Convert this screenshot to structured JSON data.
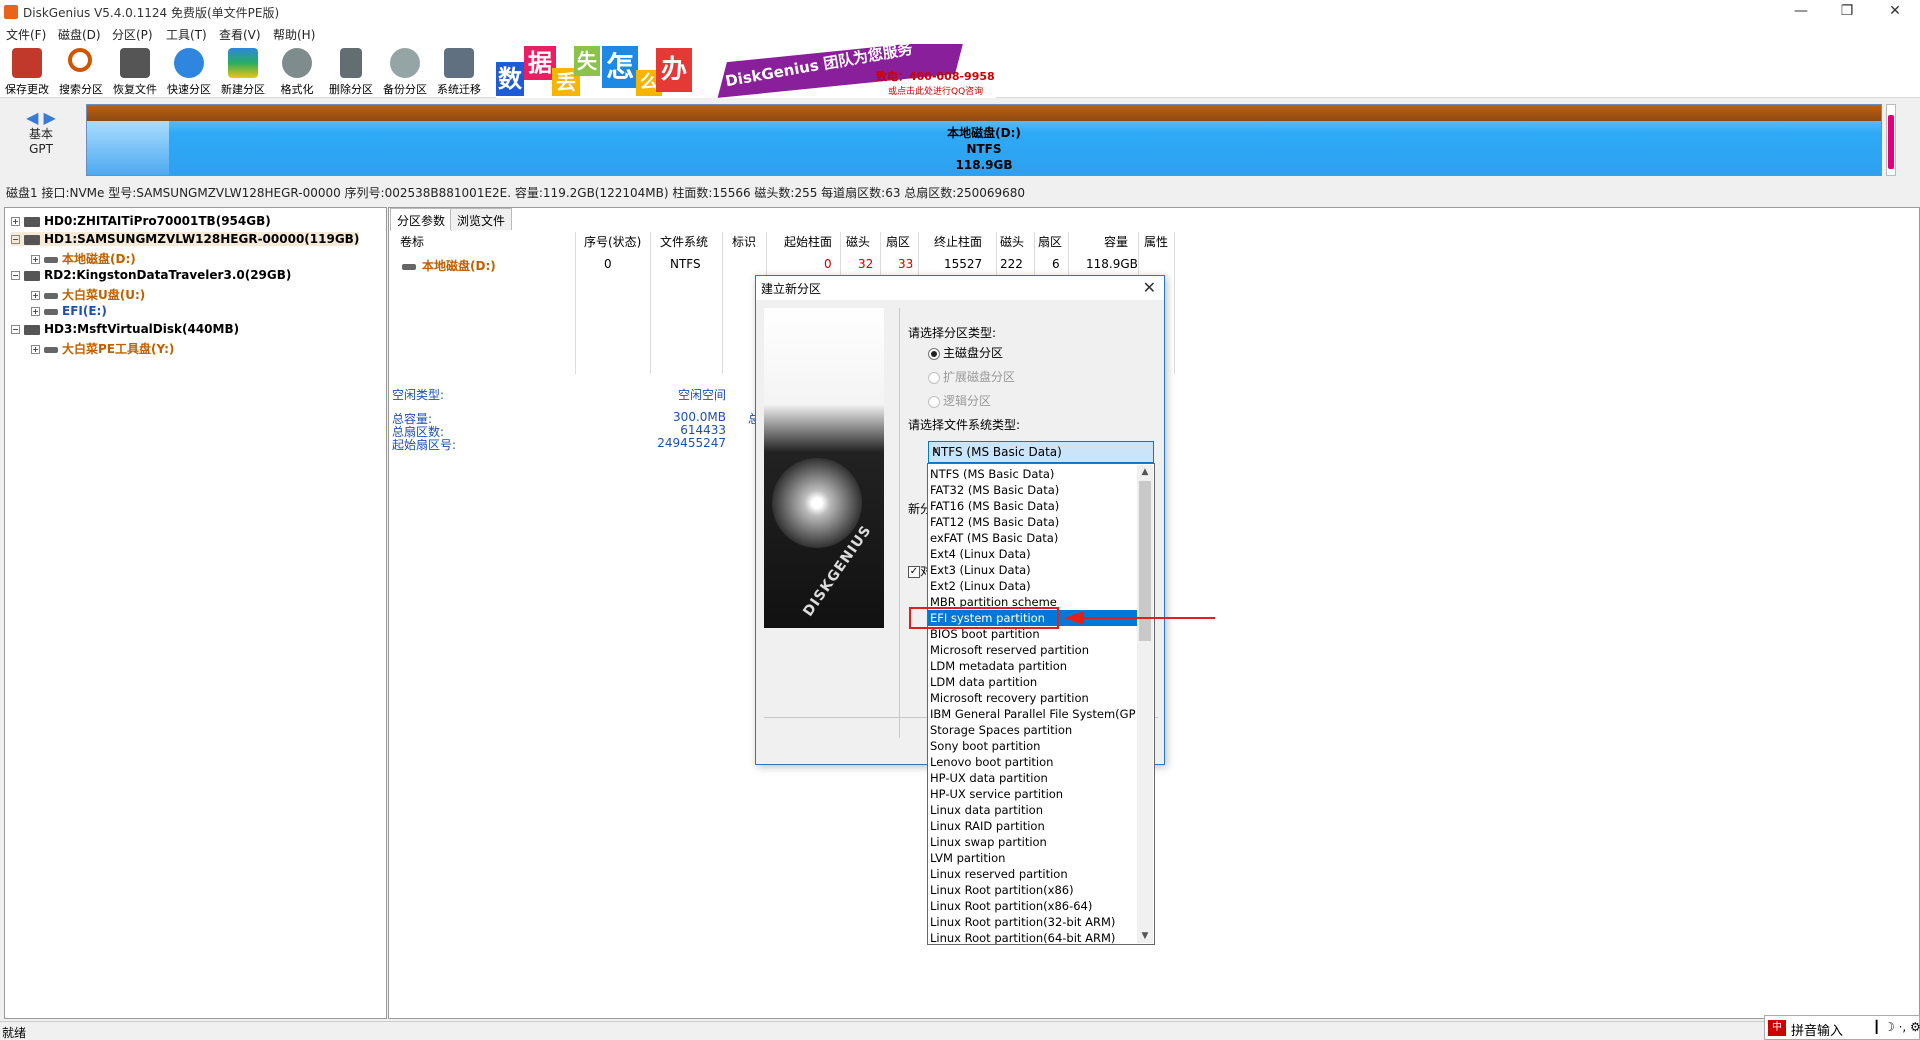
{
  "window": {
    "title": "DiskGenius V5.4.0.1124 免费版(单文件PE版)",
    "minimize_glyph": "—",
    "restore_glyph": "❐",
    "close_glyph": "✕"
  },
  "menu": [
    "文件(F)",
    "磁盘(D)",
    "分区(P)",
    "工具(T)",
    "查看(V)",
    "帮助(H)"
  ],
  "toolbar": [
    {
      "label": "保存更改",
      "icon": "save-icon",
      "color": "#c0392b"
    },
    {
      "label": "搜索分区",
      "icon": "search-icon",
      "color": "#d35400"
    },
    {
      "label": "恢复文件",
      "icon": "recover-icon",
      "color": "#555555"
    },
    {
      "label": "快速分区",
      "icon": "quick-partition-icon",
      "color": "#2e86de"
    },
    {
      "label": "新建分区",
      "icon": "new-partition-icon",
      "color": "#27ae60"
    },
    {
      "label": "格式化",
      "icon": "format-icon",
      "color": "#7f8c8d"
    },
    {
      "label": "删除分区",
      "icon": "delete-icon",
      "color": "#636e72"
    },
    {
      "label": "备份分区",
      "icon": "backup-icon",
      "color": "#95a5a6"
    },
    {
      "label": "系统迁移",
      "icon": "migrate-icon",
      "color": "#607080"
    }
  ],
  "banner": {
    "chars": [
      "数",
      "据",
      "丢",
      "失",
      "怎",
      "么",
      "办"
    ],
    "slogan": "DiskGenius 团队为您服务",
    "phone": "致电：400-008-9958",
    "qq": "或点击此处进行QQ咨询"
  },
  "disk_nav": {
    "line1": "基本",
    "line2": "GPT",
    "arrows": "◀ ▶"
  },
  "partition_bar": {
    "name": "本地磁盘(D:)",
    "fs": "NTFS",
    "size": "118.9GB"
  },
  "disk_info": "磁盘1 接口:NVMe  型号:SAMSUNGMZVLW128HEGR-00000  序列号:002538B881001E2E.  容量:119.2GB(122104MB)  柱面数:15566  磁头数:255  每道扇区数:63  总扇区数:250069680",
  "tree": [
    {
      "label": "HD0:ZHITAITiPro70001TB(954GB)",
      "kind": "disk"
    },
    {
      "label": "HD1:SAMSUNGMZVLW128HEGR-00000(119GB)",
      "kind": "disk"
    },
    {
      "label": "本地磁盘(D:)",
      "kind": "part"
    },
    {
      "label": "RD2:KingstonDataTraveler3.0(29GB)",
      "kind": "disk"
    },
    {
      "label": "大白菜U盘(U:)",
      "kind": "part"
    },
    {
      "label": "EFI(E:)",
      "kind": "part-blue"
    },
    {
      "label": "HD3:MsftVirtualDisk(440MB)",
      "kind": "disk"
    },
    {
      "label": "大白菜PE工具盘(Y:)",
      "kind": "part"
    }
  ],
  "tabs": [
    "分区参数",
    "浏览文件"
  ],
  "table": {
    "headers": [
      "卷标",
      "序号(状态)",
      "文件系统",
      "标识",
      "起始柱面",
      "磁头",
      "扇区",
      "终止柱面",
      "磁头",
      "扇区",
      "容量",
      "属性"
    ],
    "row": [
      "本地磁盘(D:)",
      "0",
      "NTFS",
      "",
      "0",
      "32",
      "33",
      "15527",
      "222",
      "6",
      "118.9GB",
      ""
    ]
  },
  "free": {
    "type_label": "空闲类型:",
    "type_value": "空闲空间",
    "rows": [
      {
        "label": "总容量:",
        "value": "300.0MB"
      },
      {
        "label": "总扇区数:",
        "value": "614433"
      },
      {
        "label": "起始扇区号:",
        "value": "249455247"
      }
    ],
    "clipped_char": "总"
  },
  "dialog": {
    "title": "建立新分区",
    "close_glyph": "✕",
    "brand": "DISKGENIUS",
    "prompt_type": "请选择分区类型:",
    "radios": [
      {
        "label": "主磁盘分区",
        "checked": true,
        "disabled": false
      },
      {
        "label": "扩展磁盘分区",
        "checked": false,
        "disabled": true
      },
      {
        "label": "逻辑分区",
        "checked": false,
        "disabled": true
      }
    ],
    "prompt_fs": "请选择文件系统类型:",
    "partial_label": "新分",
    "check_label": "对",
    "combo_value": "NTFS (MS Basic Data)"
  },
  "dropdown": {
    "items": [
      "NTFS (MS Basic Data)",
      "FAT32 (MS Basic Data)",
      "FAT16 (MS Basic Data)",
      "FAT12 (MS Basic Data)",
      "exFAT (MS Basic Data)",
      "Ext4 (Linux Data)",
      "Ext3 (Linux Data)",
      "Ext2 (Linux Data)",
      "MBR partition scheme",
      "EFI system partition",
      "BIOS boot partition",
      "Microsoft reserved partition",
      "LDM metadata partition",
      "LDM data partition",
      "Microsoft recovery partition",
      "IBM General Parallel File System(GP",
      "Storage Spaces partition",
      "Sony boot partition",
      "Lenovo boot partition",
      "HP-UX data partition",
      "HP-UX service partition",
      "Linux data partition",
      "Linux RAID partition",
      "Linux swap partition",
      "LVM partition",
      "Linux reserved partition",
      "Linux Root partition(x86)",
      "Linux Root partition(x86-64)",
      "Linux Root partition(32-bit ARM)",
      "Linux Root partition(64-bit ARM)"
    ],
    "highlighted_index": 9,
    "arrow_up": "▲",
    "arrow_down": "▼"
  },
  "status": {
    "text": "就绪"
  },
  "ime": {
    "icon": "中",
    "text": "拼音输入",
    "extra": "┃ ☽ ·, ⚙"
  }
}
